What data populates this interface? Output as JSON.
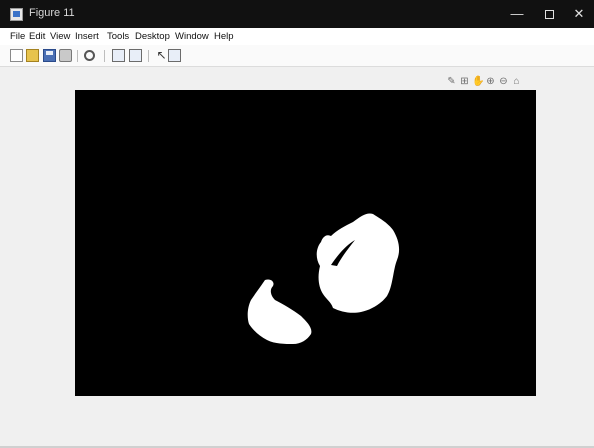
{
  "window": {
    "title": "Figure 11",
    "minimize_glyph": "—",
    "close_glyph": "✕"
  },
  "menu": {
    "items": [
      "File",
      "Edit",
      "View",
      "Insert",
      "Tools",
      "Desktop",
      "Window",
      "Help"
    ]
  },
  "toolbar": {
    "icons": [
      "new-figure-icon",
      "open-file-icon",
      "save-icon",
      "print-icon",
      "zoom-icon",
      "link-plot-icon",
      "insert-colorbar-icon",
      "edit-plot-cursor-icon",
      "plot-tools-icon"
    ]
  },
  "axes_toolbar": {
    "icons": [
      "brush-icon",
      "data-tips-icon",
      "pan-hand-icon",
      "zoom-in-icon",
      "zoom-out-icon",
      "restore-view-icon"
    ],
    "glyphs": [
      "✎",
      "⊞",
      "✋",
      "⊕",
      "⊖",
      "⌂"
    ]
  },
  "image": {
    "background_color": "#000000",
    "foreground_color": "#ffffff"
  }
}
